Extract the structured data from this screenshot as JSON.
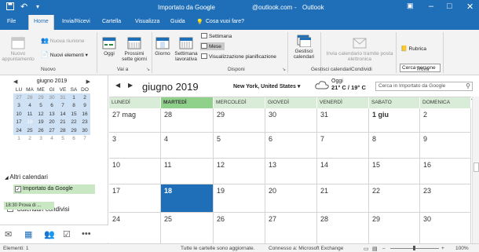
{
  "titlebar": {
    "save_icon": "floppy-icon",
    "undo_icon": "undo-icon",
    "title": "Importato da Google",
    "account": "@outlook.com",
    "app": "Outlook"
  },
  "tabs": [
    {
      "label": "File"
    },
    {
      "label": "Home",
      "active": true
    },
    {
      "label": "Invia/Ricevi"
    },
    {
      "label": "Cartella"
    },
    {
      "label": "Visualizza"
    },
    {
      "label": "Guida"
    },
    {
      "label": "Cosa vuoi fare?"
    }
  ],
  "ribbon": {
    "nuovo": {
      "appointment": "Nuovo appuntamento",
      "meeting": "Nuova riunione",
      "items": "Nuovi elementi",
      "group": "Nuovo"
    },
    "vaia": {
      "today": "Oggi",
      "next7": "Prossimi sette giorni",
      "group": "Vai a"
    },
    "disponi": {
      "day": "Giorno",
      "workweek": "Settimana lavorativa",
      "week": "Settimana",
      "month": "Mese",
      "schedule": "Visualizzazione pianificazione",
      "group": "Disponi"
    },
    "gestisci": {
      "manage": "Gestisci calendari",
      "group": "Gestisci calendari"
    },
    "condividi": {
      "email": "Invia calendario tramite posta elettronica",
      "group": "Condividi"
    },
    "trova": {
      "search_placeholder": "Cerca persone",
      "address_book": "Rubrica",
      "group": "Trova"
    }
  },
  "mini_calendar": {
    "title": "giugno 2019",
    "prev": "◀",
    "next": "▶",
    "dow": [
      "LU",
      "MA",
      "ME",
      "GI",
      "VE",
      "SA",
      "DO"
    ],
    "weeks": [
      [
        "27",
        "28",
        "29",
        "30",
        "31",
        "1",
        "2"
      ],
      [
        "3",
        "4",
        "5",
        "6",
        "7",
        "8",
        "9"
      ],
      [
        "10",
        "11",
        "12",
        "13",
        "14",
        "15",
        "16"
      ],
      [
        "17",
        "18",
        "19",
        "20",
        "21",
        "22",
        "23"
      ],
      [
        "24",
        "25",
        "26",
        "27",
        "28",
        "29",
        "30"
      ],
      [
        "1",
        "2",
        "3",
        "4",
        "5",
        "6",
        "7"
      ]
    ]
  },
  "sidebar": {
    "other_calendars": "Altri calendari",
    "google_calendar": "Importato da Google",
    "shared_calendars": "Calendari condivisi",
    "nav_icons": [
      "mail-icon",
      "calendar-icon",
      "people-icon",
      "tasks-icon",
      "more-icon"
    ]
  },
  "calendar": {
    "month_title": "giugno 2019",
    "location": "New York, United States",
    "weather_label": "Oggi",
    "weather_temp": "21° C / 19° C",
    "search_placeholder": "Cerca in Importato da Google",
    "day_headers": [
      "LUNEDÌ",
      "MARTEDÌ",
      "MERCOLEDÌ",
      "GIOVEDÌ",
      "VENERDÌ",
      "SABATO",
      "DOMENICA"
    ],
    "weeks": [
      [
        "27 mag",
        "28",
        "29",
        "30",
        "31",
        "1 giu",
        "2"
      ],
      [
        "3",
        "4",
        "5",
        "6",
        "7",
        "8",
        "9"
      ],
      [
        "10",
        "11",
        "12",
        "13",
        "14",
        "15",
        "16"
      ],
      [
        "17",
        "18",
        "19",
        "20",
        "21",
        "22",
        "23"
      ],
      [
        "24",
        "25",
        "26",
        "27",
        "28",
        "29",
        "30"
      ]
    ],
    "event": "18:30 Prova di ..."
  },
  "status": {
    "items": "Elementi: 1",
    "folders": "Tutte le cartelle sono aggiornate.",
    "connection": "Connesso a: Microsoft Exchange",
    "zoom": "100%"
  }
}
